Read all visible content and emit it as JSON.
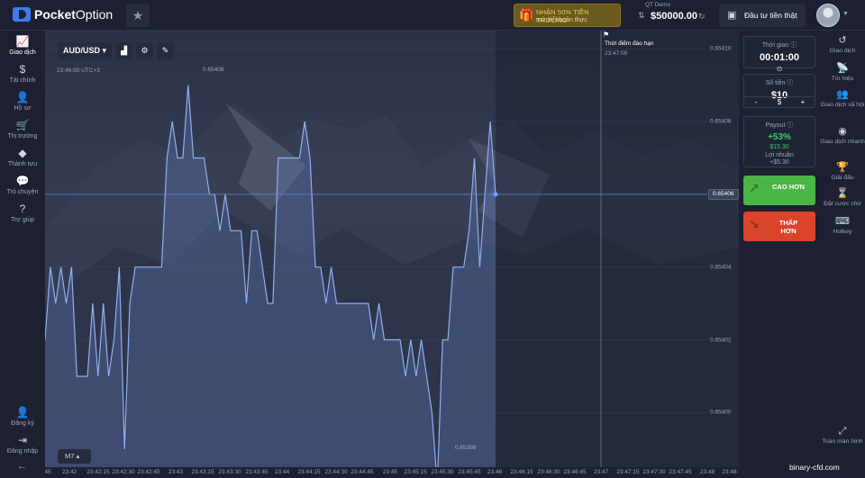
{
  "brand": {
    "name_bold": "Pocket",
    "name_rest": "Option"
  },
  "topbar": {
    "promo_line1": "NHẬN 50% TIỀN THƯỞNG",
    "promo_line2": "mở tài khoản thực",
    "account_label": "QT Demo",
    "balance": "$50000.00",
    "real_trade_label": "Đầu tư tiền thật"
  },
  "left_nav": [
    {
      "label": "Giao dịch",
      "icon": "chart-line-icon",
      "glyph": "📈"
    },
    {
      "label": "Tài chính",
      "icon": "dollar-icon",
      "glyph": "$"
    },
    {
      "label": "Hồ sơ",
      "icon": "user-icon",
      "glyph": "👤"
    },
    {
      "label": "Thị trường",
      "icon": "cart-icon",
      "glyph": "🛒"
    },
    {
      "label": "Thành tựu",
      "icon": "diamond-icon",
      "glyph": "◆"
    },
    {
      "label": "Trò chuyện",
      "icon": "chat-icon",
      "glyph": "💬"
    },
    {
      "label": "Trợ giúp",
      "icon": "help-icon",
      "glyph": "?"
    },
    {
      "label": "Đăng ký",
      "icon": "user-plus-icon",
      "glyph": "👤"
    },
    {
      "label": "Đăng nhập",
      "icon": "login-icon",
      "glyph": "⇥"
    }
  ],
  "chart_toolbar": {
    "pair": "AUD/USD"
  },
  "chart_header": {
    "time": "23:46:00 UTC+3",
    "expiry_title": "Thời điểm đáo hạn",
    "expiry_time": "23:47:00"
  },
  "timeframe": "M7",
  "current_price": "0.65406",
  "peak_labels": {
    "high": "0.65408",
    "low": "0.65398"
  },
  "trade_panel": {
    "time_label": "Thời gian",
    "time_value": "00:01:00",
    "amount_label": "Số tiền",
    "amount_value": "$10",
    "amount_minus": "-",
    "amount_currency": "$",
    "amount_plus": "+",
    "payout_label": "Payout",
    "payout_pct": "+53%",
    "payout_amount": "$15.30",
    "profit_label": "Lợi nhuận",
    "profit_value": "+$5.30",
    "up_label": "CAO HƠN",
    "down_label": "THẤP HƠN"
  },
  "right_nav": [
    {
      "label": "Giao dịch",
      "icon": "history-icon",
      "glyph": "↺"
    },
    {
      "label": "Tín hiệu",
      "icon": "signal-icon",
      "glyph": "📡"
    },
    {
      "label": "Giao dịch xã hội",
      "icon": "social-icon",
      "glyph": "👥"
    },
    {
      "label": "Giao dịch nhanh",
      "icon": "quick-trade-icon",
      "glyph": "◉"
    },
    {
      "label": "Giải đấu",
      "icon": "trophy-icon",
      "glyph": "🏆"
    },
    {
      "label": "Đặt cược chờ",
      "icon": "hourglass-icon",
      "glyph": "⌛"
    },
    {
      "label": "Hotkey",
      "icon": "keyboard-icon",
      "glyph": "⌨"
    },
    {
      "label": "Toàn màn hình",
      "icon": "fullscreen-icon",
      "glyph": "⤢"
    }
  ],
  "watermark": "binary-cfd.com",
  "chart_data": {
    "type": "area",
    "ylim": [
      0.653985,
      0.654105
    ],
    "y_ticks": [
      "0.65410",
      "0.65408",
      "0.65406",
      "0.65404",
      "0.65402",
      "0.65400"
    ],
    "x_ticks": [
      "45",
      "23:42",
      "23:42:15",
      "23:42:30",
      "23:42:45",
      "23:43",
      "23:43:15",
      "23:43:30",
      "23:43:45",
      "23:44",
      "23:44:15",
      "23:44:30",
      "23:44:45",
      "23:45",
      "23:45:15",
      "23:45:30",
      "23:45:45",
      "23:46",
      "23:46:15",
      "23:46:30",
      "23:46:45",
      "23:47",
      "23:47:15",
      "23:47:30",
      "23:47:45",
      "23:48",
      "23:48:15"
    ],
    "series": [
      {
        "values": [
          0.65402,
          0.65404,
          0.65403,
          0.65404,
          0.65403,
          0.65404,
          0.65401,
          0.65401,
          0.65401,
          0.65403,
          0.65401,
          0.65403,
          0.65401,
          0.65402,
          0.65404,
          0.65399,
          0.65403,
          0.65404,
          0.65404,
          0.65404,
          0.65404,
          0.65404,
          0.65404,
          0.65407,
          0.65408,
          0.65407,
          0.65407,
          0.65409,
          0.65407,
          0.65407,
          0.65407,
          0.65406,
          0.65406,
          0.65405,
          0.65406,
          0.65405,
          0.65405,
          0.65405,
          0.65403,
          0.65405,
          0.65405,
          0.65404,
          0.65403,
          0.65403,
          0.65407,
          0.65407,
          0.65407,
          0.65407,
          0.65407,
          0.65408,
          0.65407,
          0.65404,
          0.65404,
          0.65403,
          0.65404,
          0.65403,
          0.65403,
          0.65403,
          0.65403,
          0.65403,
          0.65403,
          0.65403,
          0.65402,
          0.65403,
          0.65402,
          0.65402,
          0.65402,
          0.65402,
          0.65401,
          0.65402,
          0.65401,
          0.65402,
          0.65401,
          0.654,
          0.65398,
          0.65402,
          0.65402,
          0.65404,
          0.65404,
          0.65404,
          0.65405,
          0.65407,
          0.65404,
          0.65406,
          0.65408,
          0.65406
        ]
      }
    ]
  }
}
